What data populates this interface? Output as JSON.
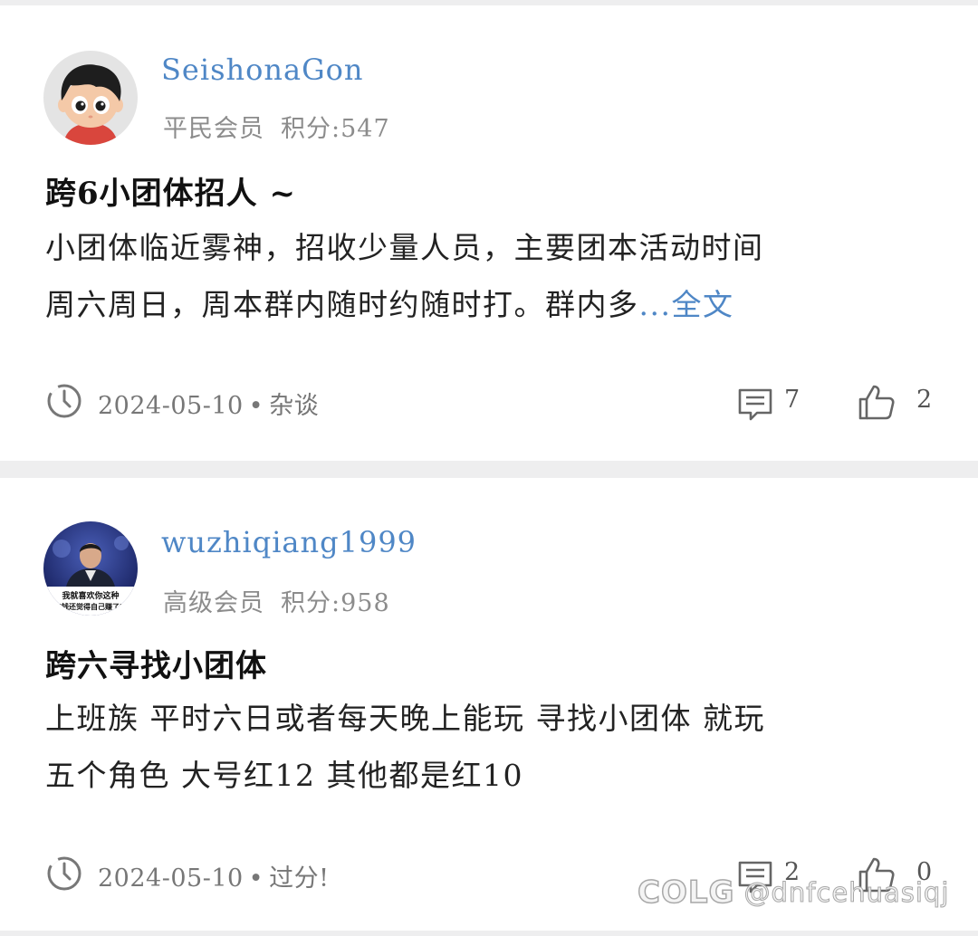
{
  "posts": [
    {
      "username": "SeishonaGon",
      "rank": "平民会员",
      "score": "积分:547",
      "title": "跨6小团体招人 ~",
      "body_lines": [
        "小团体临近雾神，招收少量人员，主要团本活动时间",
        "周六周日，周本群内随时约随时打。群内多"
      ],
      "more_link": "...全文",
      "date": "2024-05-10",
      "separator": "•",
      "category": "杂谈",
      "comments": "7",
      "likes": "2",
      "icons": [
        "clock-icon",
        "comment-icon",
        "thumbs-up-icon"
      ]
    },
    {
      "username": "wuzhiqiang1999",
      "rank": "高级会员",
      "score": "积分:958",
      "avatar_caption_1": "我就喜欢你这种",
      "avatar_caption_2": "\"钱还觉得自己赚了\"",
      "title": "跨六寻找小团体",
      "body_lines": [
        "上班族 平时六日或者每天晚上能玩 寻找小团体 就玩",
        "五个角色 大号红12 其他都是红10"
      ],
      "date": "2024-05-10",
      "separator": "•",
      "category": "过分!",
      "comments": "2",
      "likes": "0",
      "icons": [
        "clock-icon",
        "comment-icon",
        "thumbs-up-icon"
      ]
    }
  ],
  "watermark": {
    "logo": "COLG",
    "handle": "@dnfcehuasiqj"
  },
  "colors": {
    "link": "#4f87c6",
    "meta": "#8c8c8c",
    "background": "#eeeeef",
    "card": "#ffffff"
  }
}
